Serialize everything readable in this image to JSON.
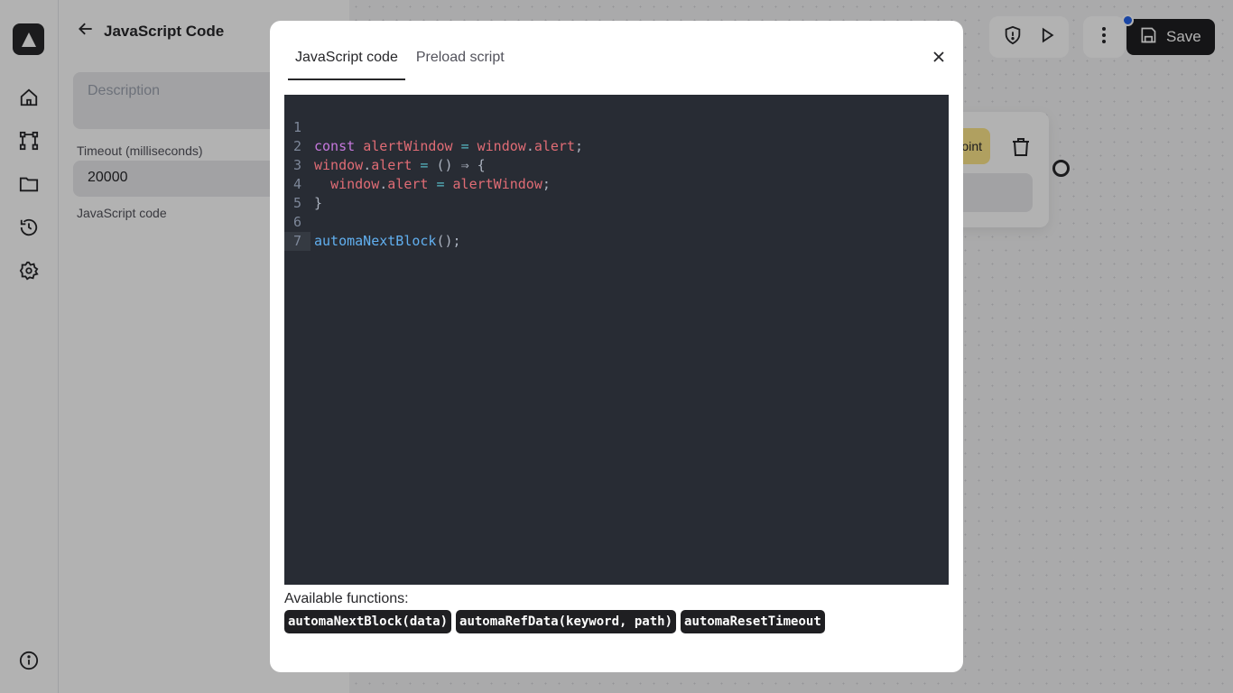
{
  "nav": {
    "items": [
      "home-icon",
      "workflow-icon",
      "folder-icon",
      "history-icon",
      "settings-icon"
    ],
    "bottom": "info-icon"
  },
  "panel": {
    "title": "JavaScript Code",
    "description_placeholder": "Description",
    "timeout_label": "Timeout (milliseconds)",
    "timeout_value": "20000",
    "code_label": "JavaScript code"
  },
  "toolbar": {
    "save_label": "Save"
  },
  "node": {
    "chip_text": "oint"
  },
  "modal": {
    "tabs": [
      {
        "label": "JavaScript code",
        "active": true
      },
      {
        "label": "Preload script",
        "active": false
      }
    ],
    "editor": {
      "line_numbers": [
        "1",
        "2",
        "3",
        "4",
        "5",
        "6",
        "7"
      ],
      "current_line": 7
    },
    "available_label": "Available functions:",
    "functions": [
      "automaNextBlock(data)",
      "automaRefData(keyword, path)",
      "automaResetTimeout"
    ]
  },
  "colors": {
    "editor_bg": "#282c34",
    "keyword": "#c678dd",
    "variable": "#e06c75",
    "operator": "#56b6c2",
    "function": "#61afef",
    "accent_dark": "#1f1f22",
    "status_dot": "#2563eb"
  }
}
